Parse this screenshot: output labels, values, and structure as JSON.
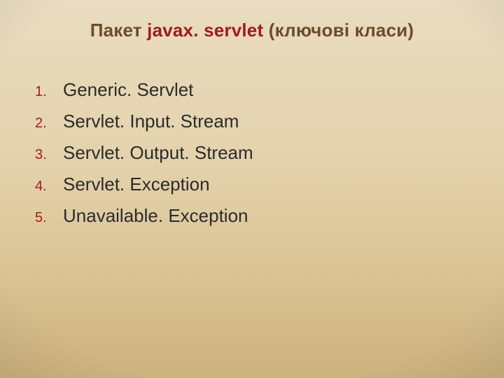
{
  "title": {
    "pre": "Пакет ",
    "mid": "javax. servlet",
    "post": " (ключові класи)"
  },
  "list": {
    "items": [
      {
        "num": "1.",
        "text": "Generic. Servlet"
      },
      {
        "num": "2.",
        "text": "Servlet. Input. Stream"
      },
      {
        "num": "3.",
        "text": "Servlet. Output. Stream"
      },
      {
        "num": "4.",
        "text": "Servlet. Exception"
      },
      {
        "num": "5.",
        "text": "Unavailable. Exception"
      }
    ]
  }
}
